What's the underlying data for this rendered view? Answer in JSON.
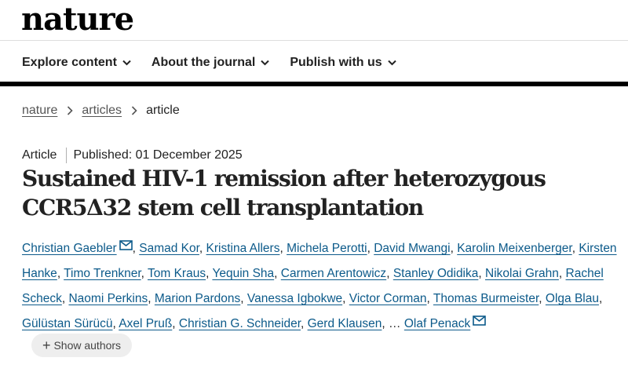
{
  "header": {
    "logo": "nature"
  },
  "nav": {
    "items": [
      "Explore content",
      "About the journal",
      "Publish with us"
    ]
  },
  "breadcrumb": {
    "items": [
      "nature",
      "articles"
    ],
    "current": "article"
  },
  "meta": {
    "type": "Article",
    "published": "Published: 01 December 2025"
  },
  "title": "Sustained HIV-1 remission after heterozygous CCR5Δ32 stem cell transplantation",
  "authors": {
    "list": [
      "Christian Gaebler",
      "Samad Kor",
      "Kristina Allers",
      "Michela Perotti",
      "David Mwangi",
      "Karolin Meixenberger",
      "Kirsten Hanke",
      "Timo Trenkner",
      "Tom Kraus",
      "Yequin Sha",
      "Carmen Arentowicz",
      "Stanley Odidika",
      "Nikolai Grahn",
      "Rachel Scheck",
      "Naomi Perkins",
      "Marion Pardons",
      "Vanessa Igbokwe",
      "Victor Corman",
      "Thomas Burmeister",
      "Olga Blau",
      "Gülüstan Sürücü",
      "Axel Pruß",
      "Christian G. Schneider",
      "Gerd Klausen",
      "Olaf Penack"
    ],
    "ellipsis": "…",
    "show_more": "Show authors"
  },
  "colors": {
    "link": "#0c5a8a",
    "text": "#222222",
    "button_bg": "#eeeeee"
  },
  "icons": {
    "nav": "chevron-down-icon",
    "breadcrumb": "chevron-right-icon",
    "email": "mail-icon",
    "expand": "plus-icon"
  }
}
